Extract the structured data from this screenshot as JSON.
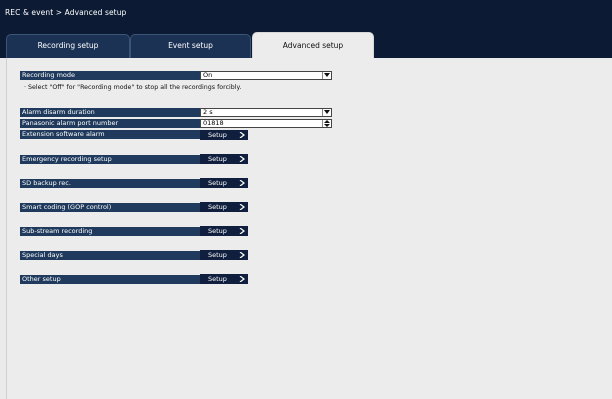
{
  "breadcrumb": "REC & event > Advanced setup",
  "tabs": [
    {
      "label": "Recording setup"
    },
    {
      "label": "Event setup"
    },
    {
      "label": "Advanced setup"
    }
  ],
  "recording_mode": {
    "label": "Recording mode",
    "value": "On"
  },
  "note": "· Select \"Off\" for \"Recording mode\" to stop all the recordings forcibly.",
  "alarm_disarm": {
    "label": "Alarm disarm duration",
    "value": "2 s"
  },
  "alarm_port": {
    "label": "Panasonic alarm port number",
    "value": "01818"
  },
  "setup_rows": [
    {
      "label": "Extension software alarm",
      "button": "Setup"
    },
    {
      "label": "Emergency recording setup",
      "button": "Setup"
    },
    {
      "label": "SD backup rec.",
      "button": "Setup"
    },
    {
      "label": "Smart coding (GOP control)",
      "button": "Setup"
    },
    {
      "label": "Sub-stream recording",
      "button": "Setup"
    },
    {
      "label": "Special days",
      "button": "Setup"
    },
    {
      "label": "Other setup",
      "button": "Setup"
    }
  ],
  "colors": {
    "header": "#0c1a34",
    "tab": "#1b3254",
    "label_bg": "#1f3a5c",
    "button_bg": "#0f1f3d",
    "panel": "#ececec"
  },
  "icons": {
    "dropdown": "chevron-down-icon",
    "spinner": "spinner-icon",
    "button": "chevron-right-icon"
  }
}
